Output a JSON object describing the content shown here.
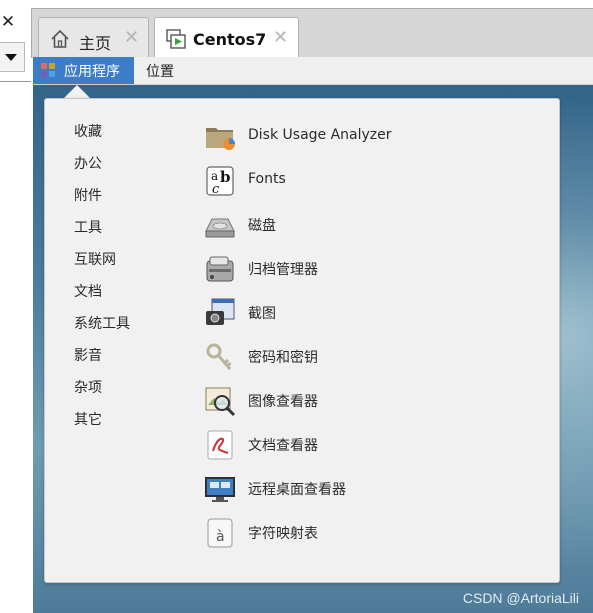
{
  "host": {
    "close_glyph": "✕",
    "tabs": [
      {
        "label": "主页",
        "icon": "home-icon",
        "close": "✕"
      },
      {
        "label": "Centos7",
        "icon": "vm-icon",
        "close": "✕"
      }
    ]
  },
  "panel": {
    "applications_label": "应用程序",
    "places_label": "位置"
  },
  "menu": {
    "categories": [
      "收藏",
      "办公",
      "附件",
      "工具",
      "互联网",
      "文档",
      "系统工具",
      "影音",
      "杂项",
      "其它"
    ],
    "apps": [
      {
        "label": "Disk Usage Analyzer",
        "icon": "disk-usage-analyzer-icon"
      },
      {
        "label": "Fonts",
        "icon": "fonts-icon"
      },
      {
        "label": "磁盘",
        "icon": "disks-icon"
      },
      {
        "label": "归档管理器",
        "icon": "archive-manager-icon"
      },
      {
        "label": "截图",
        "icon": "screenshot-icon"
      },
      {
        "label": "密码和密钥",
        "icon": "passwords-keys-icon"
      },
      {
        "label": "图像查看器",
        "icon": "image-viewer-icon"
      },
      {
        "label": "文档查看器",
        "icon": "document-viewer-icon"
      },
      {
        "label": "远程桌面查看器",
        "icon": "remote-desktop-viewer-icon"
      },
      {
        "label": "字符映射表",
        "icon": "character-map-icon"
      }
    ]
  },
  "watermark": "CSDN @ArtoriaLili",
  "colors": {
    "accent": "#3d7dc7",
    "menu_bg": "#f1f1f1",
    "tab_active": "#ffffff"
  }
}
